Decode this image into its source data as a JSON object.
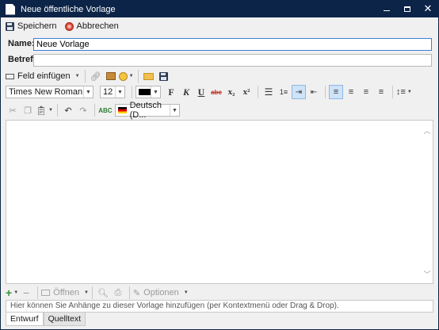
{
  "window": {
    "title": "Neue öffentliche Vorlage",
    "buttons": {
      "minimize": "minimize",
      "maximize": "maximize",
      "close": "✕"
    }
  },
  "actions": {
    "save_label": "Speichern",
    "cancel_label": "Abbrechen"
  },
  "form": {
    "name_label": "Name:",
    "name_value": "Neue Vorlage",
    "subject_label": "Betreff:",
    "subject_value": ""
  },
  "toolbar": {
    "field_insert_label": "Feld einfügen",
    "font_family": "Times New Roman",
    "font_size": "12",
    "text_color": "#000000",
    "bold": "F",
    "italic": "K",
    "underline": "U",
    "strikethrough": "abc",
    "subscript": "x₂",
    "superscript": "x²",
    "language": "Deutsch (D..."
  },
  "attachments": {
    "open_label": "Öffnen",
    "options_label": "Optionen",
    "hint": "Hier können Sie Anhänge zu dieser Vorlage hinzufügen (per Kontextmenü oder Drag & Drop)."
  },
  "tabs": [
    {
      "label": "Entwurf",
      "active": true
    },
    {
      "label": "Quelltext",
      "active": false
    }
  ],
  "colors": {
    "titlebar": "#0b2447",
    "accent": "#3c7fd6",
    "background": "#f0f0f0"
  }
}
